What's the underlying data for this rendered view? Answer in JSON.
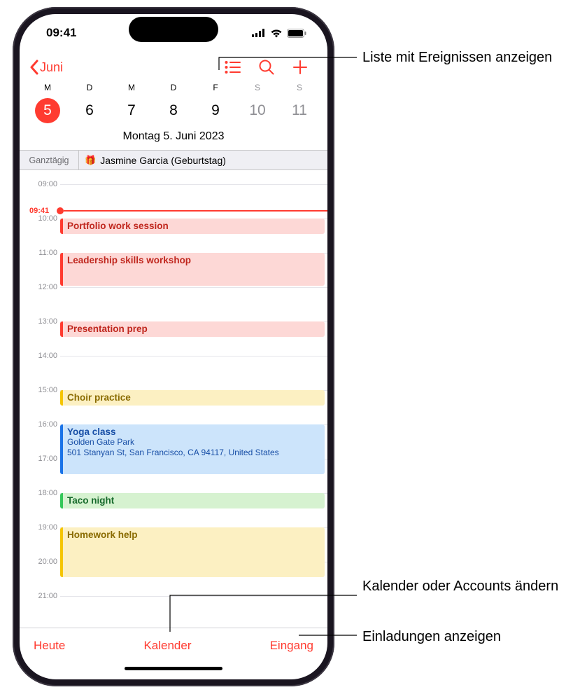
{
  "status": {
    "time": "09:41"
  },
  "nav": {
    "back_label": "Juni"
  },
  "weekdays": [
    "M",
    "D",
    "M",
    "D",
    "F",
    "S",
    "S"
  ],
  "daynums": [
    "5",
    "6",
    "7",
    "8",
    "9",
    "10",
    "11"
  ],
  "date_line": "Montag  5. Juni 2023",
  "allday": {
    "label": "Ganztägig",
    "event": "Jasmine Garcia (Geburtstag)"
  },
  "now_time": "09:41",
  "hours": [
    "09:00",
    "10:00",
    "11:00",
    "12:00",
    "13:00",
    "14:00",
    "15:00",
    "16:00",
    "17:00",
    "18:00",
    "19:00",
    "20:00",
    "21:00"
  ],
  "events": [
    {
      "title": "Portfolio work session",
      "color": "red",
      "start": 10,
      "end": 10.5
    },
    {
      "title": "Leadership skills workshop",
      "color": "red",
      "start": 11,
      "end": 12
    },
    {
      "title": "Presentation prep",
      "color": "red",
      "start": 13,
      "end": 13.5
    },
    {
      "title": "Choir practice",
      "color": "yellow",
      "start": 15,
      "end": 15.5
    },
    {
      "title": "Yoga class",
      "loc1": "Golden Gate Park",
      "loc2": "501 Stanyan St, San Francisco, CA 94117, United States",
      "color": "blue",
      "start": 16,
      "end": 17.5
    },
    {
      "title": "Taco night",
      "color": "green",
      "start": 18,
      "end": 18.5
    },
    {
      "title": "Homework help",
      "color": "yellow",
      "start": 19,
      "end": 20.5
    }
  ],
  "toolbar": {
    "today": "Heute",
    "calendars": "Kalender",
    "inbox": "Eingang"
  },
  "annotations": {
    "list": "Liste mit Ereignissen anzeigen",
    "calendars": "Kalender oder Accounts ändern",
    "inbox": "Einladungen anzeigen"
  }
}
